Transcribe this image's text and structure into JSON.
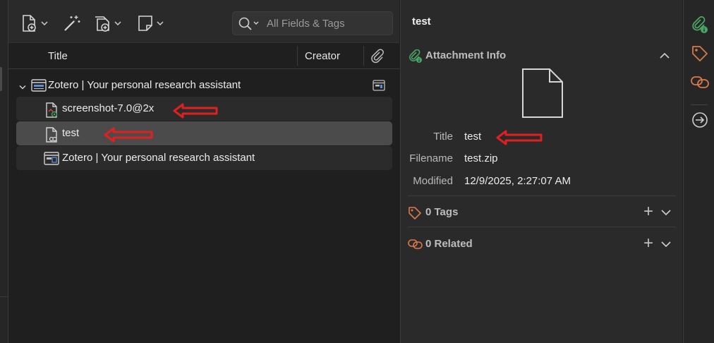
{
  "toolbar": {
    "new_item_icon": "new-item-icon",
    "wand_icon": "add-by-identifier-icon",
    "attachment_icon": "add-attachment-icon",
    "note_icon": "new-note-icon",
    "search_placeholder": "All Fields & Tags"
  },
  "columns": {
    "title": "Title",
    "creator": "Creator",
    "attachments_icon": "paperclip-icon"
  },
  "items": [
    {
      "label": "Zotero | Your personal research assistant",
      "icon": "webpage-icon",
      "level": "top"
    },
    {
      "label": "screenshot-7.0@2x",
      "icon": "image-attachment-icon",
      "level": "child"
    },
    {
      "label": "test",
      "icon": "file-link-icon",
      "level": "child",
      "selected": true
    },
    {
      "label": "Zotero | Your personal research assistant",
      "icon": "snapshot-icon",
      "level": "child"
    }
  ],
  "item_pane": {
    "header_title": "test",
    "attachment_section": {
      "label": "Attachment Info",
      "icon": "attachment-info-icon"
    },
    "fields": [
      {
        "label": "Title",
        "value": "test"
      },
      {
        "label": "Filename",
        "value": "test.zip"
      },
      {
        "label": "Modified",
        "value": "12/9/2025, 2:27:07 AM"
      }
    ],
    "tags_section": {
      "label": "0 Tags",
      "icon": "tag-icon"
    },
    "related_section": {
      "label": "0 Related",
      "icon": "related-icon"
    }
  },
  "colors": {
    "accent_green": "#4aa564",
    "accent_orange": "#d9794a",
    "annotation_red": "#e02020",
    "selected_row": "#4b4b4b"
  }
}
